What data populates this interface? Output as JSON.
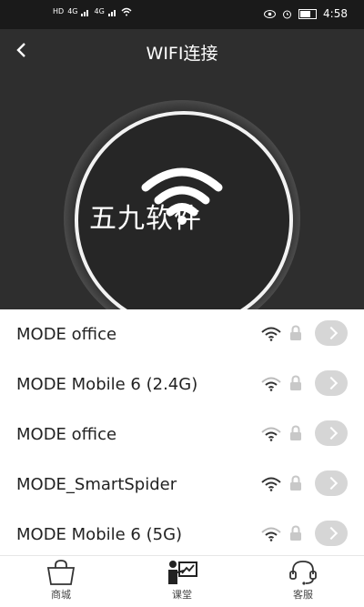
{
  "status_bar": {
    "left_badges": [
      "HD",
      "4G",
      "4G"
    ],
    "time": "4:58"
  },
  "header": {
    "back_label": "<",
    "title": "WIFI连接",
    "watermark": "五九软件"
  },
  "networks": [
    {
      "name": "MODE office"
    },
    {
      "name": "MODE Mobile 6 (2.4G)"
    },
    {
      "name": "MODE office"
    },
    {
      "name": "MODE_SmartSpider"
    },
    {
      "name": "MODE Mobile 6 (5G)"
    }
  ],
  "tabbar": {
    "tabs": [
      {
        "label": "商城",
        "icon": "shopping-bag-icon"
      },
      {
        "label": "课堂",
        "icon": "classroom-icon"
      },
      {
        "label": "客服",
        "icon": "headset-icon"
      }
    ]
  }
}
